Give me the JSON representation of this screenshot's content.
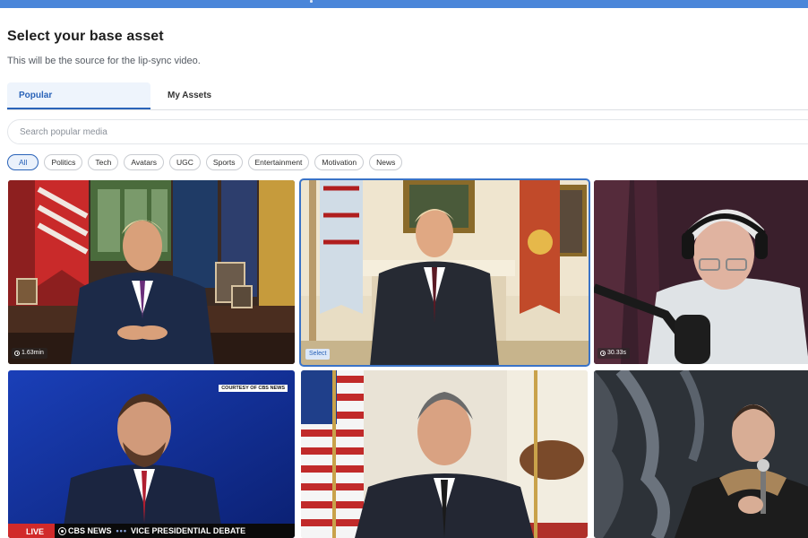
{
  "page": {
    "title": "Select your base asset",
    "subtitle": "This will be the source for the lip-sync video."
  },
  "tabs": [
    {
      "label": "Popular",
      "active": true
    },
    {
      "label": "My Assets",
      "active": false
    }
  ],
  "search": {
    "placeholder": "Search popular media",
    "value": ""
  },
  "filters": [
    {
      "label": "All",
      "active": true
    },
    {
      "label": "Politics"
    },
    {
      "label": "Tech"
    },
    {
      "label": "Avatars"
    },
    {
      "label": "UGC"
    },
    {
      "label": "Sports"
    },
    {
      "label": "Entertainment"
    },
    {
      "label": "Motivation"
    },
    {
      "label": "News"
    }
  ],
  "media": [
    {
      "duration": "1.63min"
    },
    {
      "select_label": "Select",
      "selected": true
    },
    {
      "duration": "30.33s"
    },
    {
      "overlay_top": "COURTESY OF CBS NEWS",
      "lower_live": "LIVE",
      "lower_network": "CBS NEWS",
      "lower_title": "VICE PRESIDENTIAL DEBATE"
    },
    {},
    {}
  ],
  "colors": {
    "accent": "#2a63b8",
    "topbar": "#4a86d9",
    "tab_active_bg": "#eef4fc"
  }
}
